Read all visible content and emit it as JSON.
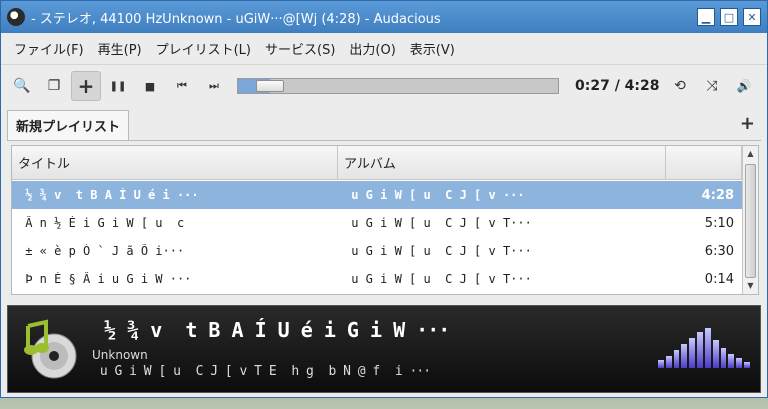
{
  "window": {
    "title": "- ステレオ, 44100 HzUnknown - ￼u￼G￼i￼W···￼@￼[￼W￼￼￼￼￼j (4:28) - Audacious",
    "min_glyph": "▁",
    "max_glyph": "□",
    "close_glyph": "✕"
  },
  "menubar": {
    "items": [
      "ファイル(F)",
      "再生(P)",
      "プレイリスト(L)",
      "サービス(S)",
      "出力(O)",
      "表示(V)"
    ]
  },
  "toolbar": {
    "icons": [
      "search-icon",
      "playlist-icon",
      "add-icon",
      "pause-icon",
      "stop-icon",
      "previous-icon",
      "next-icon"
    ],
    "glyphs": {
      "search": "🔍",
      "playlist": "❐",
      "add": "+",
      "pause": "❚❚",
      "stop": "■",
      "prev": "⏮",
      "next": "⏭",
      "repeat": "⟲",
      "shuffle": "⤨",
      "volume": "🔊"
    },
    "seek_progress": 0.1,
    "time": "0:27 / 4:28"
  },
  "tabs": {
    "active": "新規プレイリスト",
    "add_glyph": "+"
  },
  "playlist": {
    "columns": {
      "title": "タイトル",
      "album": "アルバム",
      "length": ""
    },
    "rows": [
      {
        "title": "￼½￼¾￼v￼￼t￼B￼A￼Í￼U￼é￼i￼···",
        "album": "￼u￼G￼i￼W￼[￼u￼￼C￼J￼[￼v￼···",
        "length": "4:28",
        "selected": true
      },
      {
        "title": "￼Â￼n￼½￼É￼i￼G￼i￼W￼[￼u￼￼c",
        "album": "￼u￼G￼i￼W￼[￼u￼￼C￼J￼[￼v￼T···",
        "length": "5:10",
        "selected": false
      },
      {
        "title": "￼±￼«￼è￼p￼Ò￼`￼J￼ã￼Õ￼i···",
        "album": "￼u￼G￼i￼W￼[￼u￼￼C￼J￼[￼v￼T···",
        "length": "6:30",
        "selected": false
      },
      {
        "title": "￼Þ￼n￼É￼§￼Â￼i￼u￼G￼i￼W￼···",
        "album": "￼u￼G￼i￼W￼[￼u￼￼C￼J￼[￼v￼T···",
        "length": "0:14",
        "selected": false
      }
    ]
  },
  "now_playing": {
    "title": "￼½￼¾￼v￼￼t￼B￼A￼Í￼U￼é￼i￼G￼i￼W￼···",
    "artist": "Unknown",
    "album": "￼u￼G￼i￼W￼[￼u￼￼C￼J￼[￼v￼T￼E￼￼h￼g￼￼b￼N￼@￼f￼￼i￼···",
    "viz_levels": [
      0.2,
      0.3,
      0.45,
      0.6,
      0.75,
      0.9,
      1.0,
      0.7,
      0.5,
      0.35,
      0.25,
      0.15
    ]
  }
}
